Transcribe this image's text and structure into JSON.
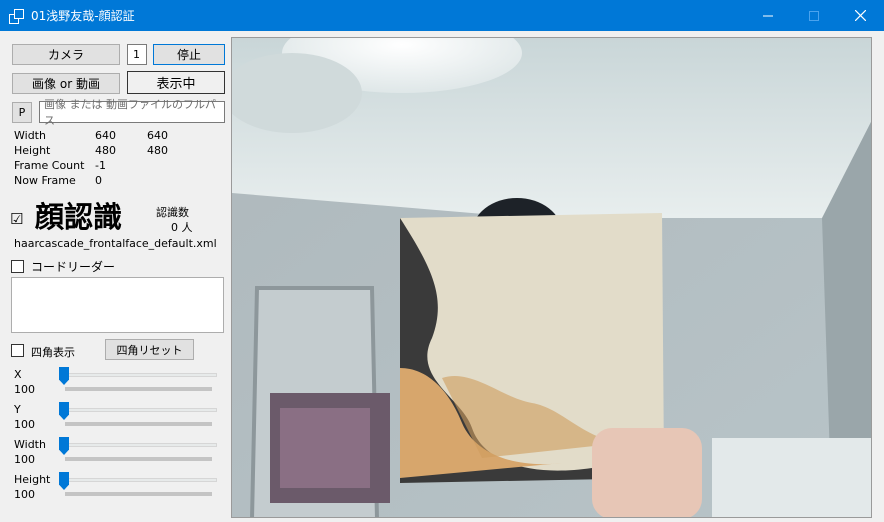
{
  "window": {
    "title": "01浅野友哉-顔認証"
  },
  "titlebar_icons": {
    "minimize": "minimize-icon",
    "maximize": "maximize-icon",
    "close": "close-icon"
  },
  "camera": {
    "button_label": "カメラ",
    "index_value": "1",
    "stop_label": "停止"
  },
  "media": {
    "button_label": "画像 or 動画",
    "status_label": "表示中"
  },
  "path": {
    "button_label": "P",
    "placeholder": "画像 または 動画ファイルのフルパス"
  },
  "info": {
    "width_label": "Width",
    "width_a": "640",
    "width_b": "640",
    "height_label": "Height",
    "height_a": "480",
    "height_b": "480",
    "frame_count_label": "Frame Count",
    "frame_count": "-1",
    "now_frame_label": "Now Frame",
    "now_frame": "0"
  },
  "face": {
    "checked": true,
    "check_mark": "☑",
    "title": "顔認識",
    "count_label": "認識数",
    "count_value": "0 人",
    "cascade_file": "haarcascade_frontalface_default.xml"
  },
  "code_reader": {
    "checked": false,
    "label": "コードリーダー"
  },
  "rect": {
    "checked": false,
    "label": "四角表示",
    "reset_label": "四角リセット"
  },
  "sliders": [
    {
      "label": "X",
      "value": "100",
      "level": 0
    },
    {
      "label": "Y",
      "value": "100",
      "level": 0
    },
    {
      "label": "Width",
      "value": "100",
      "level": 0
    },
    {
      "label": "Height",
      "value": "100",
      "level": 0
    }
  ]
}
